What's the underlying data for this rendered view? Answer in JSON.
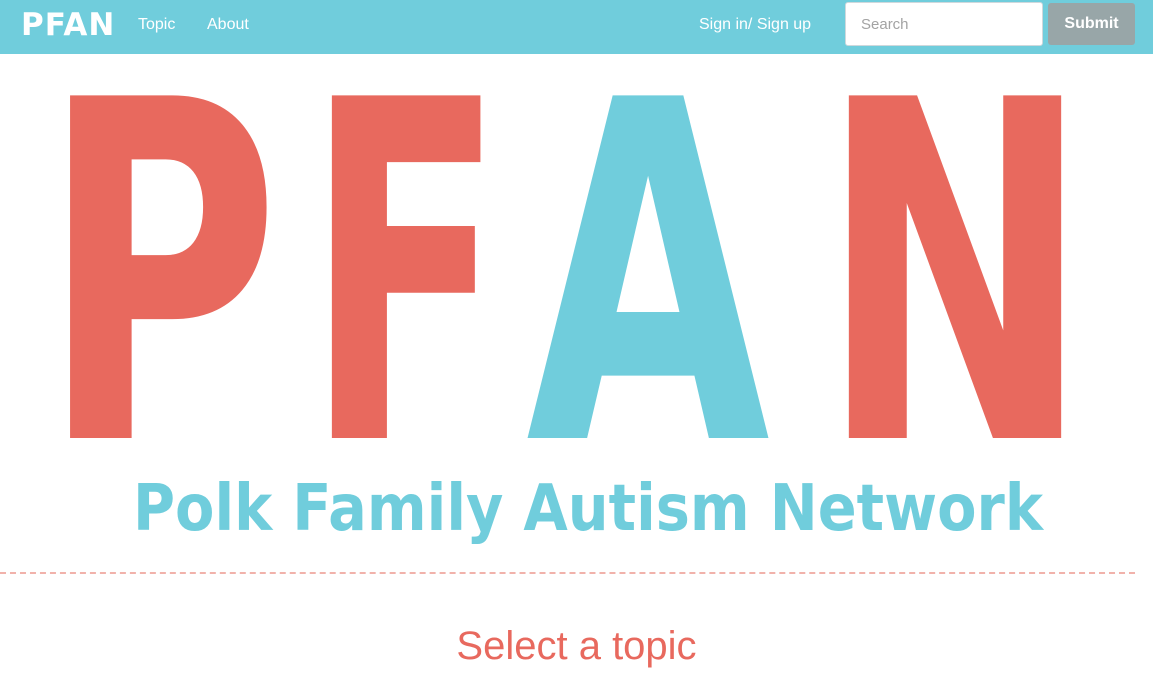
{
  "navbar": {
    "brand": "PFAN",
    "links": [
      "Topic",
      "About"
    ],
    "sign_in": "Sign in/ Sign up",
    "search_placeholder": "Search",
    "submit_label": "Submit",
    "bg_color": "#70cddc"
  },
  "hero": {
    "logo_letters": [
      "P",
      "F",
      "A",
      "N"
    ],
    "logo_colors": [
      "#e8695e",
      "#e8695e",
      "#70cddc",
      "#e8695e"
    ],
    "tagline": "Polk Family Autism Network",
    "tagline_color": "#70cddc"
  },
  "main": {
    "topic_heading": "Select a topic"
  }
}
